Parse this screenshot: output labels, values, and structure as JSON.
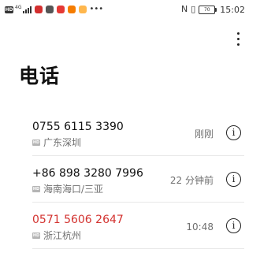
{
  "status_bar": {
    "left_badge": "HD",
    "network": "4G",
    "dots": "•••",
    "nfc_icon": "N",
    "battery": "70",
    "time": "15:02"
  },
  "header": {
    "title": "电话",
    "more_icon": "more-vertical-icon"
  },
  "calls": [
    {
      "number": "0755 6115 3390",
      "location": "广东深圳",
      "time": "刚刚",
      "missed": false,
      "badge": "HD"
    },
    {
      "number": "+86 898 3280 7996",
      "location": "海南海口/三亚",
      "time": "22 分钟前",
      "missed": false,
      "badge": "HD"
    },
    {
      "number": "0571 5606 2647",
      "location": "浙江杭州",
      "time": "10:48",
      "missed": true,
      "badge": "HD"
    }
  ],
  "colors": {
    "missed": "#d3322f",
    "secondary_text": "#6f6f6f",
    "primary_text": "#111111"
  }
}
